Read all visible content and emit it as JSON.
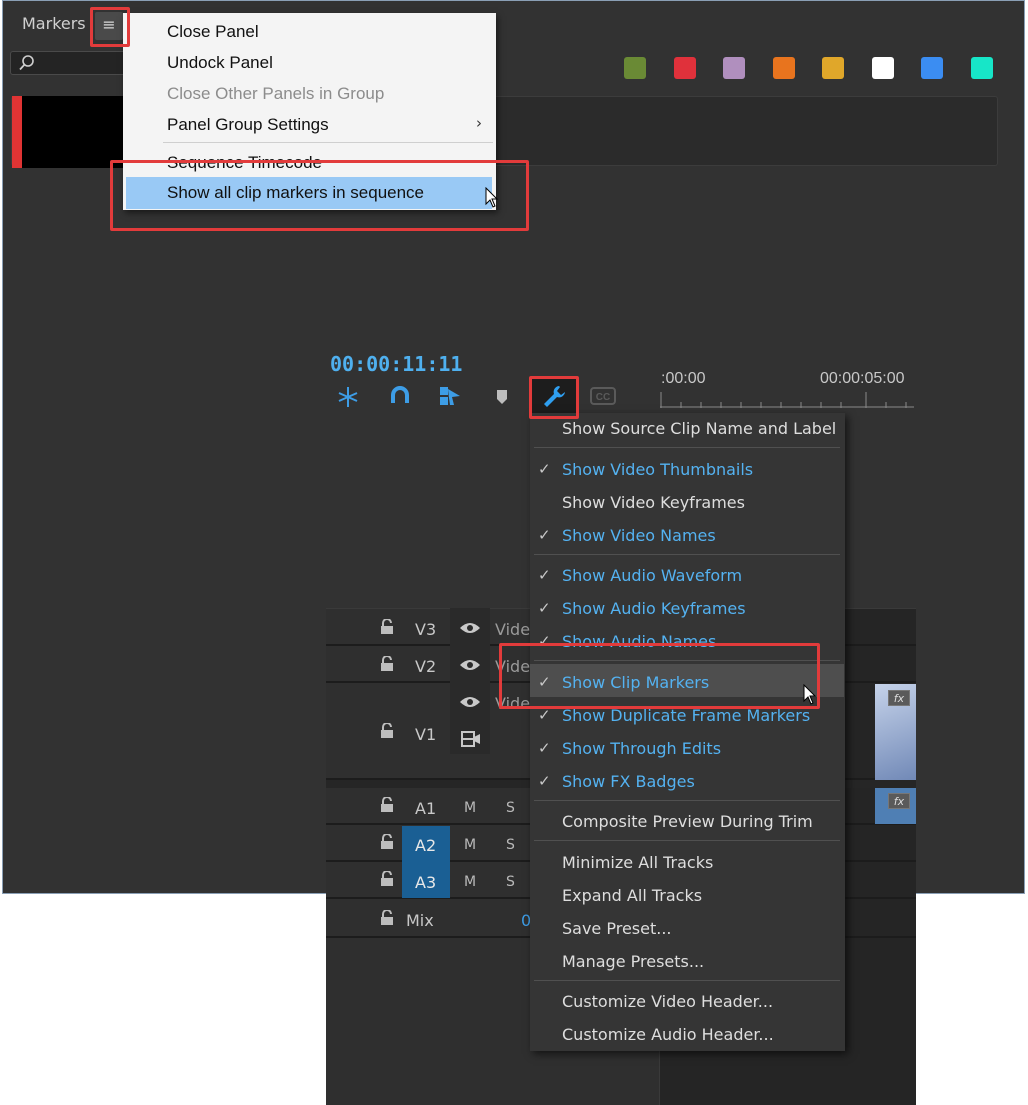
{
  "markers_panel": {
    "tab_label": "Markers",
    "menu_icon": "hamburger-menu-icon",
    "search_icon": "search-icon",
    "color_swatches": [
      "#6a8a35",
      "#e0313b",
      "#b08fbe",
      "#e8741e",
      "#e0a72a",
      "#ffffff",
      "#3b8df2",
      "#17e6c8"
    ]
  },
  "panel_menu": {
    "items": [
      {
        "label": "Close Panel",
        "enabled": true
      },
      {
        "label": "Undock Panel",
        "enabled": true
      },
      {
        "label": "Close Other Panels in Group",
        "enabled": false
      },
      {
        "label": "Panel Group Settings",
        "enabled": true,
        "submenu": true
      },
      {
        "label": "Sequence Timecode",
        "enabled": true
      },
      {
        "label": "Show all clip markers in sequence",
        "enabled": true,
        "highlighted": true
      }
    ],
    "submenu_arrow": "›"
  },
  "timeline": {
    "timecode": "00:00:11:11",
    "ruler_start": ":00:00",
    "ruler_end": "00:00:05:00",
    "tool_icons": [
      "snap-ripple-icon",
      "magnet-snap-icon",
      "linked-selection-icon",
      "add-marker-icon",
      "wrench-settings-icon",
      "closed-captions-icon"
    ],
    "tracks": {
      "v3": {
        "label": "V3",
        "name": "Vide"
      },
      "v2": {
        "label": "V2",
        "name": "Vide"
      },
      "v1": {
        "label": "V1",
        "name": "Vide"
      },
      "a1": {
        "label": "A1",
        "m": "M",
        "s": "S"
      },
      "a2": {
        "label": "A2",
        "m": "M",
        "s": "S"
      },
      "a3": {
        "label": "A3",
        "m": "M",
        "s": "S"
      },
      "mix": {
        "label": "Mix",
        "value": "0"
      }
    },
    "fx_badge": "fx"
  },
  "wrench_menu": {
    "items": [
      {
        "label": "Show Source Clip Name and Label",
        "checked": false
      },
      {
        "label": "Show Video Thumbnails",
        "checked": true
      },
      {
        "label": "Show Video Keyframes",
        "checked": false
      },
      {
        "label": "Show Video Names",
        "checked": true
      },
      {
        "label": "Show Audio Waveform",
        "checked": true
      },
      {
        "label": "Show Audio Keyframes",
        "checked": true
      },
      {
        "label": "Show Audio Names",
        "checked": true
      },
      {
        "label": "Show Clip Markers",
        "checked": true,
        "hovered": true
      },
      {
        "label": "Show Duplicate Frame Markers",
        "checked": true
      },
      {
        "label": "Show Through Edits",
        "checked": true
      },
      {
        "label": "Show FX Badges",
        "checked": true
      },
      {
        "label": "Composite Preview During Trim",
        "checked": false
      },
      {
        "label": "Minimize All Tracks",
        "checked": false
      },
      {
        "label": "Expand All Tracks",
        "checked": false
      },
      {
        "label": "Save Preset...",
        "checked": false
      },
      {
        "label": "Manage Presets...",
        "checked": false
      },
      {
        "label": "Customize Video Header...",
        "checked": false
      },
      {
        "label": "Customize Audio Header...",
        "checked": false
      }
    ],
    "check_glyph": "✓"
  },
  "colors": {
    "accent_blue": "#54b2f1",
    "callout_red": "#e23b3b",
    "marker_red": "#e03434"
  }
}
